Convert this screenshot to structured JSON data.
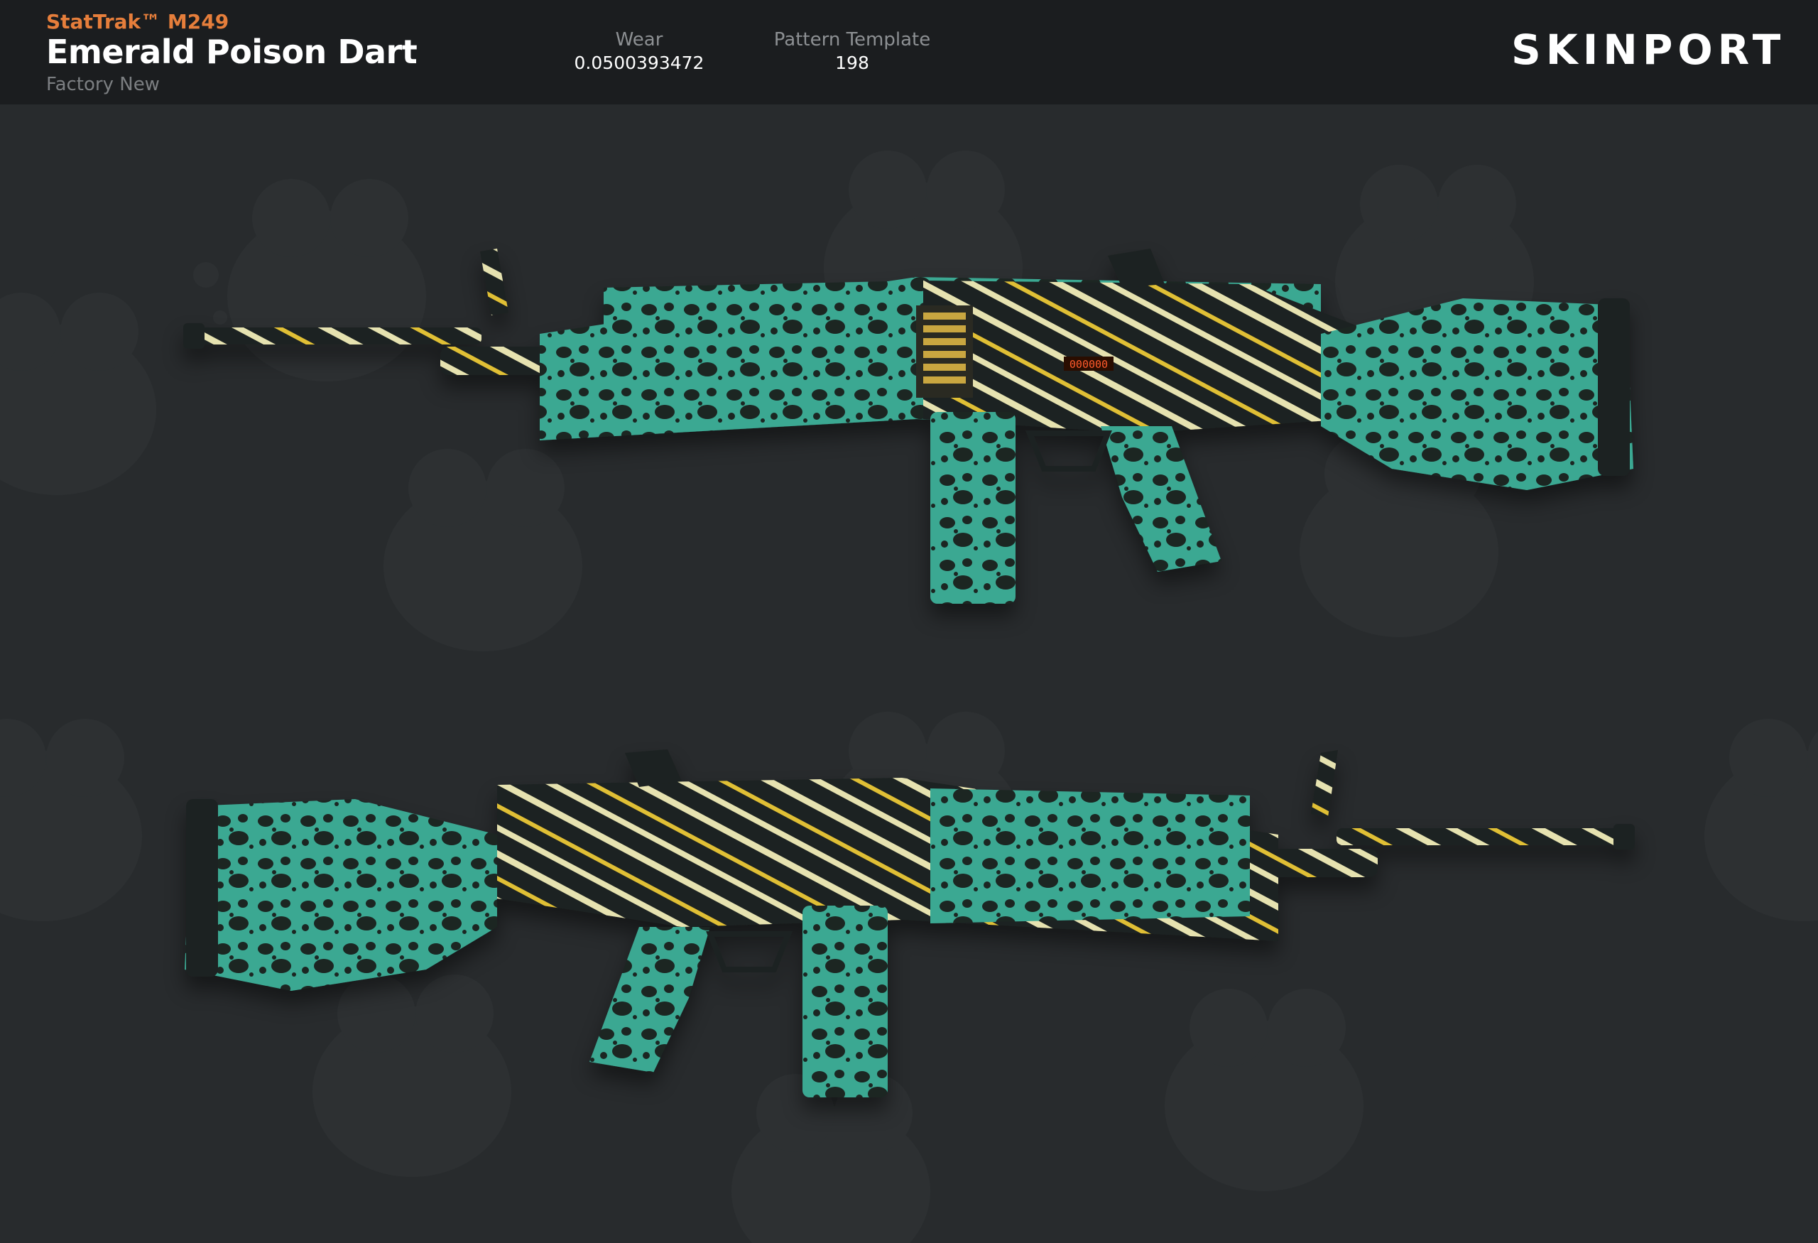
{
  "header": {
    "category": "StatTrak™ M249",
    "name": "Emerald Poison Dart",
    "exterior": "Factory New",
    "wear_label": "Wear",
    "wear_value": "0.0500393472",
    "pattern_label": "Pattern Template",
    "pattern_value": "198",
    "logo": "SKINPORT"
  },
  "colors": {
    "background": "#282b2d",
    "header": "#1b1d1f",
    "accent_category": "#e67e3b",
    "logo_accent": "#e64a2e",
    "skin_teal": "#3fae98",
    "skin_dark": "#1c2320",
    "skin_yellow": "#e2c23a",
    "skin_cream": "#e7e3b0"
  },
  "images": {
    "weapon_top": "m249-right-facing-skin-render",
    "weapon_bottom": "m249-left-facing-skin-render",
    "background": "poison-frog-skull-pattern"
  }
}
